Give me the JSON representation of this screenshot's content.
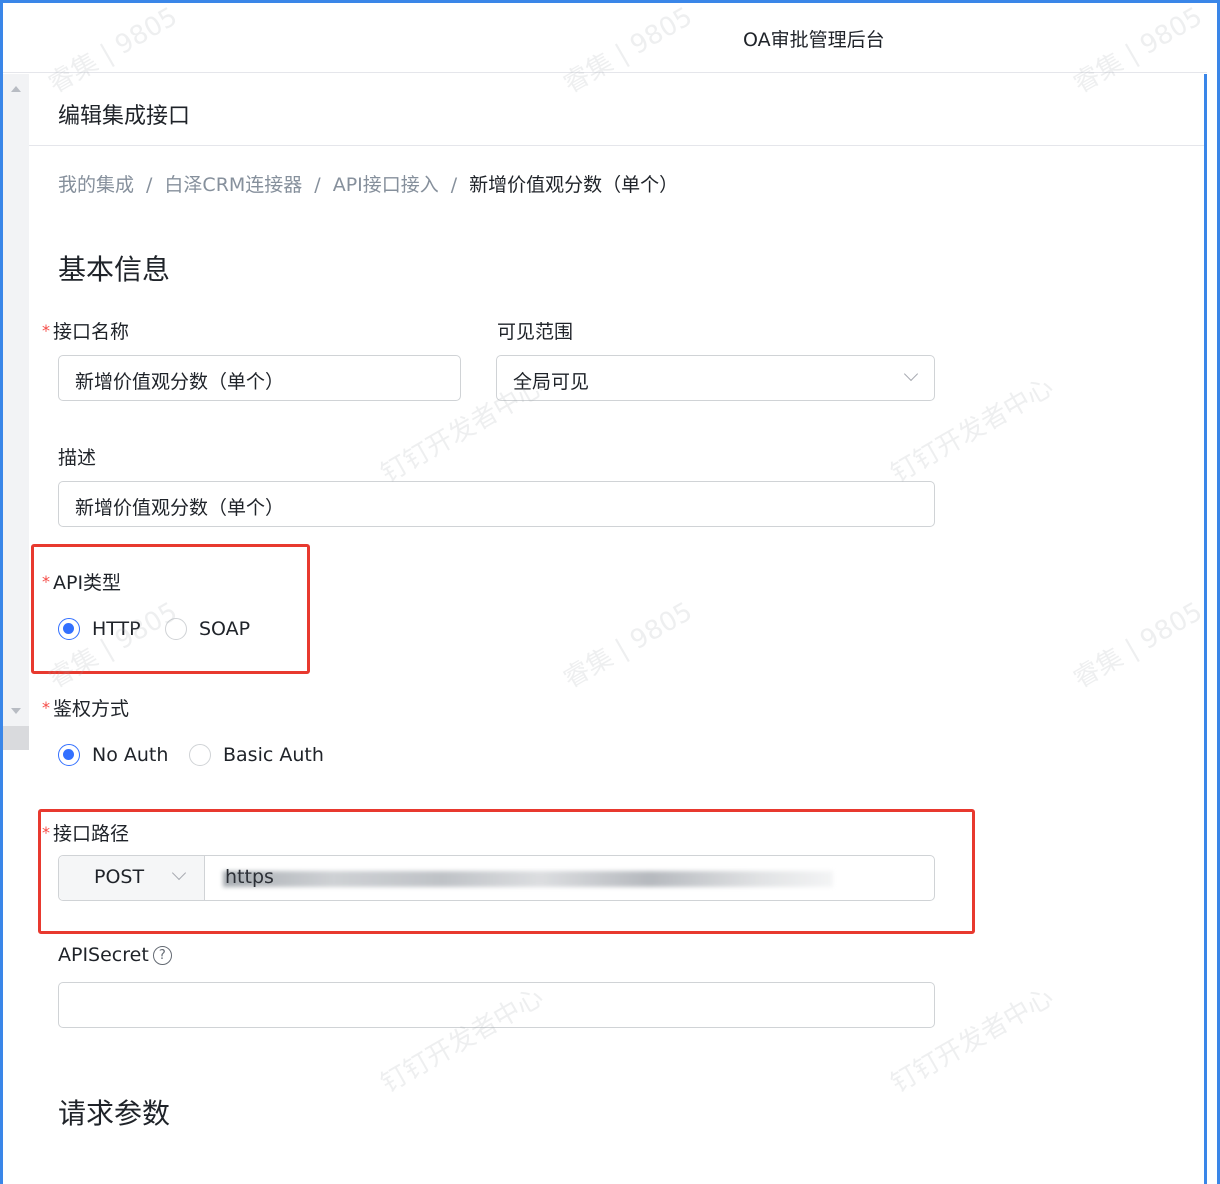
{
  "app": {
    "title": "OA审批管理后台"
  },
  "page": {
    "title": "编辑集成接口"
  },
  "breadcrumb": {
    "items": [
      "我的集成",
      "白泽CRM连接器",
      "API接口接入"
    ],
    "separator": "/",
    "current": "新增价值观分数（单个）"
  },
  "sections": {
    "basic_info": "基本信息",
    "request_params": "请求参数"
  },
  "form": {
    "name": {
      "label": "接口名称",
      "required": true,
      "value": "新增价值观分数（单个）"
    },
    "visibility": {
      "label": "可见范围",
      "value": "全局可见"
    },
    "description": {
      "label": "描述",
      "value": "新增价值观分数（单个）"
    },
    "api_type": {
      "label": "API类型",
      "required": true,
      "options": [
        "HTTP",
        "SOAP"
      ],
      "selected": "HTTP"
    },
    "auth": {
      "label": "鉴权方式",
      "required": true,
      "options": [
        "No Auth",
        "Basic Auth"
      ],
      "selected": "No Auth"
    },
    "path": {
      "label": "接口路径",
      "required": true,
      "method": "POST",
      "url_visible": "https",
      "url_redacted": true
    },
    "api_secret": {
      "label": "APISecret",
      "help_icon": "question-circle-icon",
      "value": ""
    }
  },
  "watermarks": {
    "a": "睿集 | 9805",
    "b": "钉钉开发者中心"
  },
  "colors": {
    "accent": "#3370ff",
    "required": "#f54a45",
    "highlight": "#e8392f",
    "frame": "#3a86e8"
  }
}
